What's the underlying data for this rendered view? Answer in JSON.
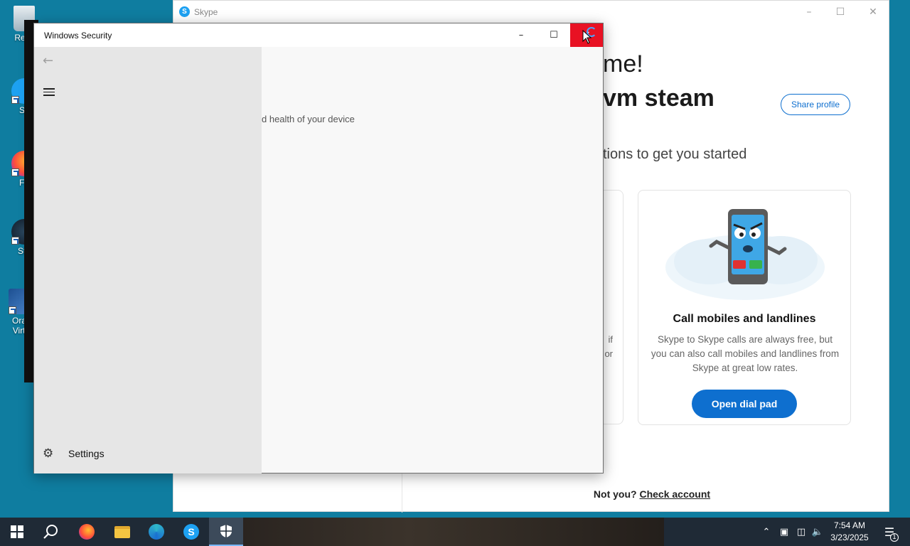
{
  "desktop": {
    "icons": [
      {
        "label": "Recy",
        "name": "recycle-bin"
      },
      {
        "label": "Sk",
        "name": "skype-shortcut"
      },
      {
        "label": "Fir",
        "name": "firefox-shortcut"
      },
      {
        "label": "Ste",
        "name": "steam-shortcut"
      },
      {
        "label": "Orac",
        "label2": "Virtu",
        "name": "virtualbox-shortcut"
      }
    ]
  },
  "skype": {
    "title": "Skype",
    "welcome_fragment": "me!",
    "user_fragment": "vm steam",
    "share_profile": "Share profile",
    "subtitle_fragment": "tions to get you started",
    "left_card_fragments": [
      "if",
      "or"
    ],
    "card": {
      "title": "Call mobiles and landlines",
      "description": "Skype to Skype calls are always free, but you can also call mobiles and landlines from Skype at great low rates.",
      "button": "Open dial pad"
    },
    "not_you": "Not you?",
    "check_account": "Check account"
  },
  "windows_security": {
    "title": "Windows Security",
    "health_fragment": "d health of your device",
    "settings_label": "Settings"
  },
  "taskbar": {
    "time": "7:54 AM",
    "date": "3/23/2025",
    "notification_count": "1"
  },
  "colors": {
    "desktop": "#0f7da0",
    "skype_blue": "#0e6fcf",
    "close_red": "#e81123",
    "taskbar": "#1f2a36"
  }
}
